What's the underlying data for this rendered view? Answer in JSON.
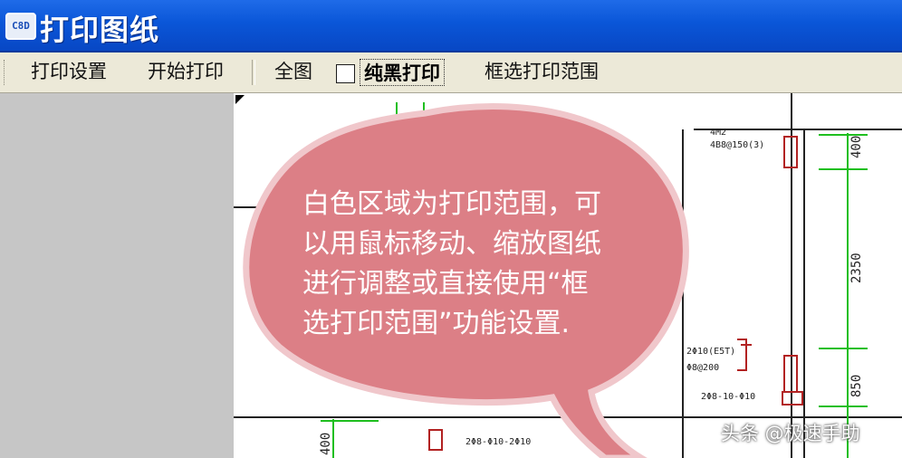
{
  "window": {
    "title": "打印图纸",
    "app_icon_text": "C8D"
  },
  "toolbar": {
    "print_settings": "打印设置",
    "start_print": "开始打印",
    "full_view": "全图",
    "pure_black_print": "纯黑打印",
    "pure_black_checked": false,
    "select_print_range": "框选打印范围"
  },
  "callout": {
    "lines": [
      "白色区域为打印范围，可",
      "以用鼠标移动、缩放图纸",
      "进行调整或直接使用“框",
      "选打印范围”功能设置."
    ],
    "fill_color": "#dc7f86",
    "border_color": "#f0c7cb"
  },
  "drawing": {
    "dims": [
      "400",
      "2350",
      "850",
      "400"
    ],
    "labels": [
      "4M2",
      "4B8@150(3)",
      "2Φ10(E5T)",
      "Φ8@200",
      "2Φ8-10-Φ10",
      "2Φ8-Φ10-2Φ10"
    ],
    "dim_color": "#1fbf1f",
    "rebar_color": "#b22222"
  },
  "watermark": "头条 @极速手助"
}
